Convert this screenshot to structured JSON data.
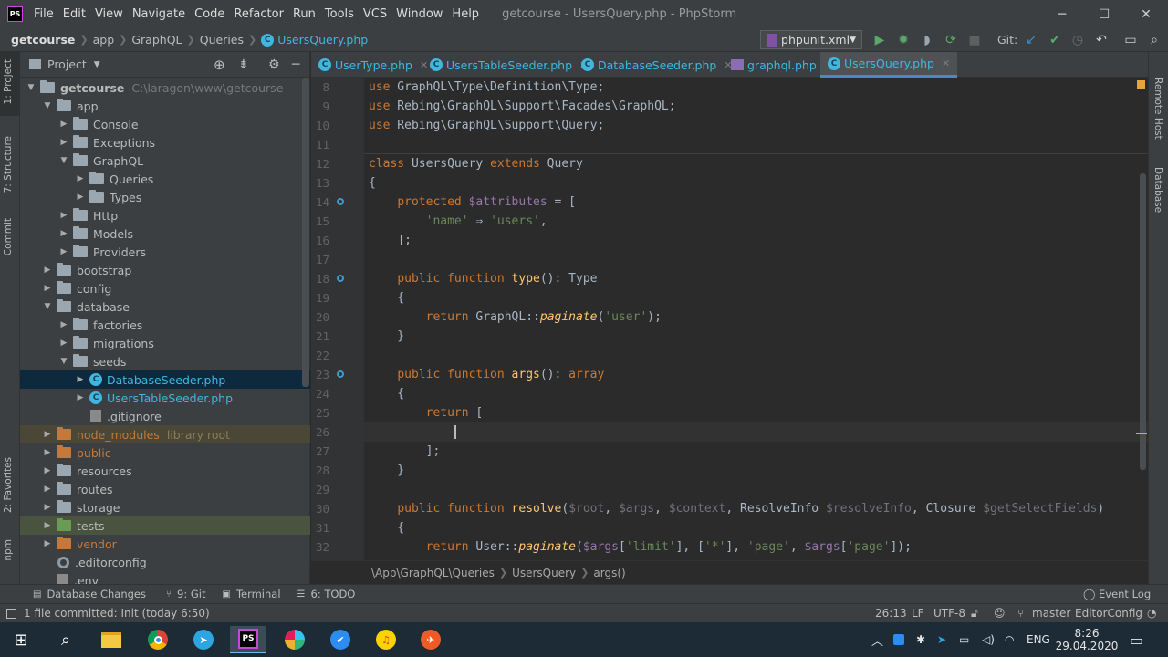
{
  "app": {
    "logo_text": "PS",
    "window_title": "getcourse - UsersQuery.php - PhpStorm"
  },
  "menu": [
    "File",
    "Edit",
    "View",
    "Navigate",
    "Code",
    "Refactor",
    "Run",
    "Tools",
    "VCS",
    "Window",
    "Help"
  ],
  "window_controls": {
    "minimize": "─",
    "maximize": "☐",
    "close": "✕"
  },
  "breadcrumb": [
    "getcourse",
    "app",
    "GraphQL",
    "Queries",
    "UsersQuery.php"
  ],
  "toolbar": {
    "run_config": "phpunit.xml",
    "git_label": "Git:"
  },
  "left_stripe": {
    "project": "1: Project",
    "structure": "7: Structure",
    "commit": "Commit",
    "favorites": "2: Favorites",
    "npm": "npm"
  },
  "right_stripe": {
    "remote_host": "Remote Host",
    "database": "Database"
  },
  "project_panel": {
    "title": "Project",
    "tree": [
      {
        "label": "getcourse",
        "extra": "C:\\laragon\\www\\getcourse",
        "indent": 0,
        "arrow": "▼",
        "icon": "folder",
        "bold": true
      },
      {
        "label": "app",
        "indent": 1,
        "arrow": "▼",
        "icon": "folder"
      },
      {
        "label": "Console",
        "indent": 2,
        "arrow": "▶",
        "icon": "folder"
      },
      {
        "label": "Exceptions",
        "indent": 2,
        "arrow": "▶",
        "icon": "folder"
      },
      {
        "label": "GraphQL",
        "indent": 2,
        "arrow": "▼",
        "icon": "folder"
      },
      {
        "label": "Queries",
        "indent": 3,
        "arrow": "▶",
        "icon": "folder"
      },
      {
        "label": "Types",
        "indent": 3,
        "arrow": "▶",
        "icon": "folder"
      },
      {
        "label": "Http",
        "indent": 2,
        "arrow": "▶",
        "icon": "folder"
      },
      {
        "label": "Models",
        "indent": 2,
        "arrow": "▶",
        "icon": "folder"
      },
      {
        "label": "Providers",
        "indent": 2,
        "arrow": "▶",
        "icon": "folder"
      },
      {
        "label": "bootstrap",
        "indent": 1,
        "arrow": "▶",
        "icon": "folder"
      },
      {
        "label": "config",
        "indent": 1,
        "arrow": "▶",
        "icon": "folder"
      },
      {
        "label": "database",
        "indent": 1,
        "arrow": "▼",
        "icon": "folder"
      },
      {
        "label": "factories",
        "indent": 2,
        "arrow": "▶",
        "icon": "folder"
      },
      {
        "label": "migrations",
        "indent": 2,
        "arrow": "▶",
        "icon": "folder"
      },
      {
        "label": "seeds",
        "indent": 2,
        "arrow": "▼",
        "icon": "folder"
      },
      {
        "label": "DatabaseSeeder.php",
        "indent": 3,
        "arrow": "▶",
        "icon": "class",
        "selected": true
      },
      {
        "label": "UsersTableSeeder.php",
        "indent": 3,
        "arrow": "▶",
        "icon": "class"
      },
      {
        "label": ".gitignore",
        "indent": 3,
        "arrow": "",
        "icon": "file"
      },
      {
        "label": "node_modules",
        "extra": "library root",
        "indent": 1,
        "arrow": "▶",
        "icon": "folder-orange",
        "highlight": "lib"
      },
      {
        "label": "public",
        "indent": 1,
        "arrow": "▶",
        "icon": "folder-orange"
      },
      {
        "label": "resources",
        "indent": 1,
        "arrow": "▶",
        "icon": "folder"
      },
      {
        "label": "routes",
        "indent": 1,
        "arrow": "▶",
        "icon": "folder"
      },
      {
        "label": "storage",
        "indent": 1,
        "arrow": "▶",
        "icon": "folder"
      },
      {
        "label": "tests",
        "indent": 1,
        "arrow": "▶",
        "icon": "folder-green",
        "highlight": "test"
      },
      {
        "label": "vendor",
        "indent": 1,
        "arrow": "▶",
        "icon": "folder-orange"
      },
      {
        "label": ".editorconfig",
        "indent": 1,
        "arrow": "",
        "icon": "gear"
      },
      {
        "label": ".env",
        "indent": 1,
        "arrow": "",
        "icon": "file"
      }
    ]
  },
  "tabs": [
    {
      "label": "UserType.php",
      "active": false
    },
    {
      "label": "UsersTableSeeder.php",
      "active": false
    },
    {
      "label": "DatabaseSeeder.php",
      "active": false
    },
    {
      "label": "graphql.php",
      "active": false
    },
    {
      "label": "UsersQuery.php",
      "active": true
    }
  ],
  "code_lines": [
    {
      "n": "8",
      "marker": false,
      "html": "<span class=\"kw\">use</span> GraphQL\\Type\\Definition\\Type;"
    },
    {
      "n": "9",
      "marker": false,
      "html": "<span class=\"kw\">use</span> Rebing\\GraphQL\\Support\\Facades\\GraphQL;"
    },
    {
      "n": "10",
      "marker": false,
      "html": "<span class=\"kw\">use</span> Rebing\\GraphQL\\Support\\Query;"
    },
    {
      "n": "11",
      "marker": false,
      "html": ""
    },
    {
      "n": "12",
      "marker": false,
      "html": "<span class=\"kw\">class</span> UsersQuery <span class=\"kw\">extends</span> Query"
    },
    {
      "n": "13",
      "marker": false,
      "html": "{"
    },
    {
      "n": "14",
      "marker": true,
      "html": "    <span class=\"kw\">protected</span> <span class=\"var\">$attributes</span> = ["
    },
    {
      "n": "15",
      "marker": false,
      "html": "        <span class=\"str\">'name'</span> ⇒ <span class=\"str\">'users'</span>,"
    },
    {
      "n": "16",
      "marker": false,
      "html": "    ];"
    },
    {
      "n": "17",
      "marker": false,
      "html": ""
    },
    {
      "n": "18",
      "marker": true,
      "html": "    <span class=\"kw\">public function</span> <span class=\"fn\">type</span>(): Type"
    },
    {
      "n": "19",
      "marker": false,
      "html": "    {"
    },
    {
      "n": "20",
      "marker": false,
      "html": "        <span class=\"kw\">return</span> GraphQL::<span class=\"it\">paginate</span>(<span class=\"str\">'user'</span>);"
    },
    {
      "n": "21",
      "marker": false,
      "html": "    }"
    },
    {
      "n": "22",
      "marker": false,
      "html": ""
    },
    {
      "n": "23",
      "marker": true,
      "html": "    <span class=\"kw\">public function</span> <span class=\"fn\">args</span>(): <span class=\"kw\">array</span>"
    },
    {
      "n": "24",
      "marker": false,
      "html": "    {"
    },
    {
      "n": "25",
      "marker": false,
      "html": "        <span class=\"kw\">return</span> ["
    },
    {
      "n": "26",
      "marker": false,
      "html": "            <span style=\"border-left:2px solid #bbbbbb\">&nbsp;</span>"
    },
    {
      "n": "27",
      "marker": false,
      "html": "        ];"
    },
    {
      "n": "28",
      "marker": false,
      "html": "    }"
    },
    {
      "n": "29",
      "marker": false,
      "html": ""
    },
    {
      "n": "30",
      "marker": false,
      "html": "    <span class=\"kw\">public function</span> <span class=\"fn\">resolve</span>(<span class=\"dim\">$root</span>, <span class=\"dim\">$args</span>, <span class=\"dim\">$context</span>, ResolveInfo <span class=\"dim\">$resolveInfo</span>, Closure <span class=\"dim\">$getSelectFields</span>)"
    },
    {
      "n": "31",
      "marker": false,
      "html": "    {"
    },
    {
      "n": "32",
      "marker": false,
      "html": "        <span class=\"kw\">return</span> User::<span class=\"it\">paginate</span>(<span class=\"var\">$args</span>[<span class=\"str\">'limit'</span>], [<span class=\"str\">'*'</span>], <span class=\"str\">'page'</span>, <span class=\"var\">$args</span>[<span class=\"str\">'page'</span>]);"
    }
  ],
  "editor_breadcrumb": [
    "\\App\\GraphQL\\Queries",
    "UsersQuery",
    "args()"
  ],
  "tool_windows": [
    "Database Changes",
    "9: Git",
    "Terminal",
    "6: TODO"
  ],
  "event_log": "Event Log",
  "status": {
    "message": "1 file committed: Init (today 6:50)",
    "position": "26:13",
    "line_sep": "LF",
    "encoding": "UTF-8",
    "branch": "master",
    "editorconfig": "EditorConfig"
  },
  "taskbar": {
    "lang": "ENG",
    "time": "8:26",
    "date": "29.04.2020"
  },
  "colors": {
    "accent": "#3592c4",
    "keyword": "#cc7832",
    "string": "#6a8759",
    "variable": "#9876aa"
  }
}
